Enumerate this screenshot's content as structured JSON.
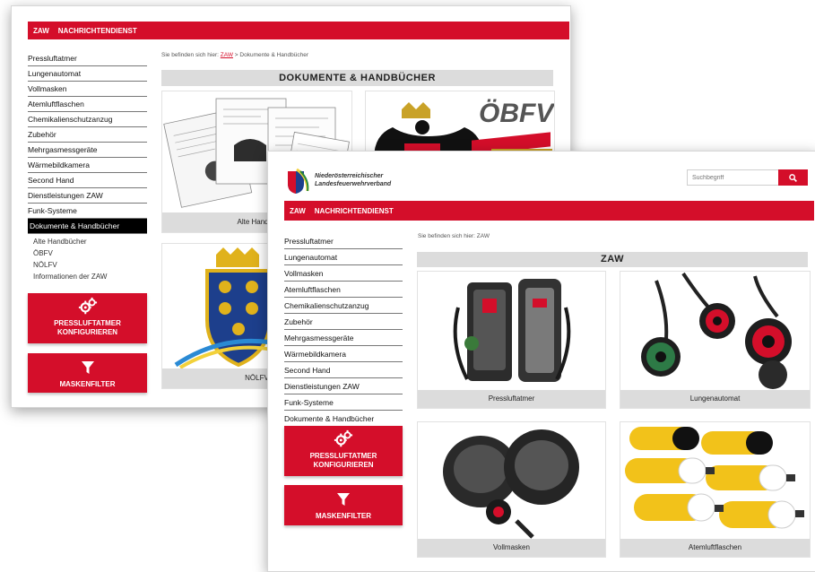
{
  "back": {
    "topnav": [
      "ZAW",
      "NACHRICHTENDIENST"
    ],
    "sidebar": [
      "Pressluftatmer",
      "Lungenautomat",
      "Vollmasken",
      "Atemluftflaschen",
      "Chemikalienschutzanzug",
      "Zubehör",
      "Mehrgasmessgeräte",
      "Wärmebildkamera",
      "Second Hand",
      "Dienstleistungen ZAW",
      "Funk-Systeme"
    ],
    "active_item": "Dokumente & Handbücher",
    "subitems": [
      "Alte Handbücher",
      "ÖBFV",
      "NÖLFV",
      "Informationen der ZAW"
    ],
    "cta1": {
      "line1": "PRESSLUFTATMER",
      "line2": "KONFIGURIEREN"
    },
    "cta2": {
      "label": "MASKENFILTER"
    },
    "breadcrumb": {
      "prefix": "Sie befinden sich hier:",
      "link": "ZAW",
      "separator": ">",
      "current": "Dokumente & Handbücher"
    },
    "title": "DOKUMENTE & HANDBÜCHER",
    "cards": [
      {
        "caption": "Alte Handbü"
      },
      {
        "logo_text": "ÖBFV"
      },
      {
        "caption": "NÖLFV"
      }
    ]
  },
  "front": {
    "logo": {
      "line1": "Niederösterreichischer",
      "line2": "Landesfeuerwehrverband"
    },
    "search": {
      "placeholder": "Suchbegriff"
    },
    "topnav": [
      "ZAW",
      "NACHRICHTENDIENST"
    ],
    "sidebar": [
      "Pressluftatmer",
      "Lungenautomat",
      "Vollmasken",
      "Atemluftflaschen",
      "Chemikalienschutzanzug",
      "Zubehör",
      "Mehrgasmessgeräte",
      "Wärmebildkamera",
      "Second Hand",
      "Dienstleistungen ZAW",
      "Funk-Systeme",
      "Dokumente & Handbücher"
    ],
    "cta1": {
      "line1": "PRESSLUFTATMER",
      "line2": "KONFIGURIEREN"
    },
    "cta2": {
      "label": "MASKENFILTER"
    },
    "breadcrumb": {
      "prefix": "Sie befinden sich hier:",
      "current": "ZAW"
    },
    "title": "ZAW",
    "products": [
      {
        "caption": "Pressluftatmer",
        "icon": "breathing-apparatus"
      },
      {
        "caption": "Lungenautomat",
        "icon": "lung-demand-valve"
      },
      {
        "caption": "Vollmasken",
        "icon": "full-face-mask"
      },
      {
        "caption": "Atemluftflaschen",
        "icon": "air-cylinders"
      }
    ]
  },
  "colors": {
    "brand_red": "#d40e2a",
    "caption_gray": "#dcdcdc",
    "black": "#000000"
  }
}
